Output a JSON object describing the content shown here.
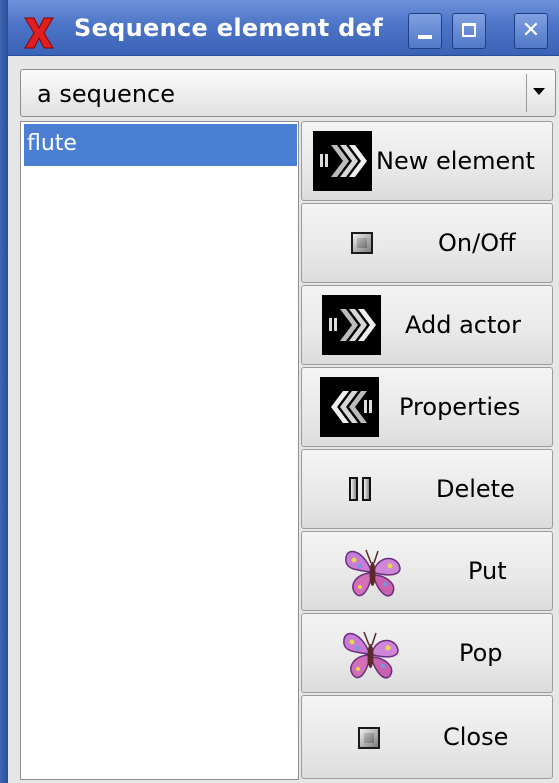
{
  "window": {
    "title": "Sequence element def",
    "minimize_icon": "minimize-icon",
    "maximize_icon": "maximize-icon",
    "close_glyph": "✕",
    "app_icon": "x-logo-icon"
  },
  "combo": {
    "selected": "a sequence"
  },
  "list": {
    "items": [
      {
        "label": "flute",
        "selected": true
      }
    ]
  },
  "buttons": {
    "new_element": {
      "label": "New element",
      "icon": "forward-arrows-icon"
    },
    "on_off": {
      "label": "On/Off",
      "icon": "stop-square-icon"
    },
    "add_actor": {
      "label": "Add actor",
      "icon": "forward-arrows-icon"
    },
    "properties": {
      "label": "Properties",
      "icon": "backward-arrows-icon"
    },
    "delete": {
      "label": "Delete",
      "icon": "pause-icon"
    },
    "put": {
      "label": "Put",
      "icon": "butterfly-icon"
    },
    "pop": {
      "label": "Pop",
      "icon": "butterfly-icon"
    },
    "close": {
      "label": "Close",
      "icon": "stop-square-icon"
    }
  },
  "colors": {
    "titlebar": "#4d74c6",
    "selection": "#4a7fd4",
    "button_face": "#e8e8e8"
  }
}
